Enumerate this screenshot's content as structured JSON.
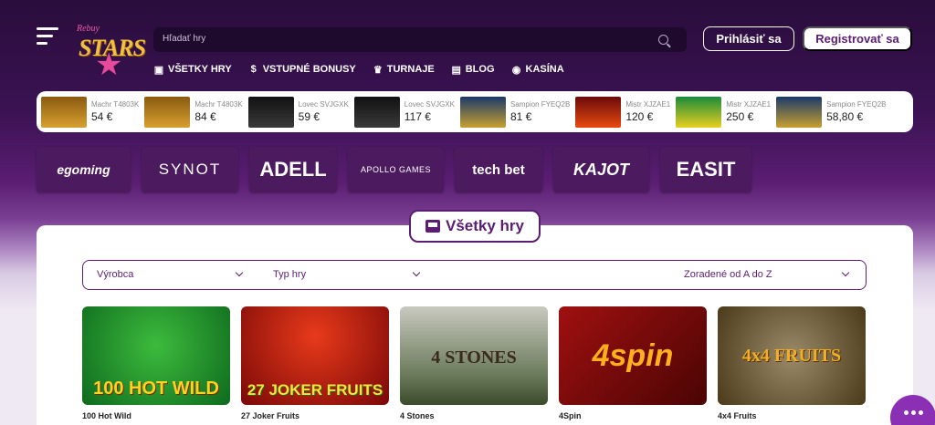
{
  "header": {
    "logo_top": "Rebuy",
    "logo_main": "STARS",
    "search_placeholder": "Hľadať hry",
    "login_label": "Prihlásiť sa",
    "register_label": "Registrovať sa"
  },
  "nav": [
    {
      "icon": "slot-machine-icon",
      "label": "VŠETKY HRY"
    },
    {
      "icon": "dollar-icon",
      "label": "VSTUPNÉ BONUSY"
    },
    {
      "icon": "trophy-icon",
      "label": "TURNAJE"
    },
    {
      "icon": "chat-icon",
      "label": "BLOG"
    },
    {
      "icon": "chips-icon",
      "label": "KASÍNA"
    }
  ],
  "ticker": [
    {
      "user": "Machr T4803K",
      "amount": "54 €",
      "thumb": "4 fruits"
    },
    {
      "user": "Machr T4803K",
      "amount": "84 €",
      "thumb": "4 fruits"
    },
    {
      "user": "Lovec SVJGXK",
      "amount": "59 €",
      "thumb": "zuppa"
    },
    {
      "user": "Lovec SVJGXK",
      "amount": "117 €",
      "thumb": "zuppa"
    },
    {
      "user": "Sampion FYEQ2B",
      "amount": "81 €",
      "thumb": "money vaults"
    },
    {
      "user": "Mistr XJZAE1",
      "amount": "120 €",
      "thumb": "81"
    },
    {
      "user": "Mistr XJZAE1",
      "amount": "250 €",
      "thumb": "hot wild"
    },
    {
      "user": "Sampion FYEQ2B",
      "amount": "58,80 €",
      "thumb": "money vaults"
    }
  ],
  "providers": [
    {
      "label": "egoming",
      "style": "bold-italic"
    },
    {
      "label": "SYNOT",
      "style": "wide"
    },
    {
      "label": "ADELL",
      "style": "heavy"
    },
    {
      "label": "APOLLO GAMES",
      "style": "small"
    },
    {
      "label": "tech bet",
      "style": "stack"
    },
    {
      "label": "KAJOT",
      "style": "italic"
    },
    {
      "label": "EASIT",
      "style": "heavy"
    }
  ],
  "section": {
    "title": "Všetky hry"
  },
  "filters": {
    "manufacturer": "Výrobca",
    "game_type": "Typ hry",
    "sort": "Zoradené od A do Z"
  },
  "games": [
    {
      "title": "100 Hot Wild",
      "art_text": "100 HOT WILD"
    },
    {
      "title": "27 Joker Fruits",
      "art_text": "27 JOKER FRUITS"
    },
    {
      "title": "4 Stones",
      "art_text": "4 STONES"
    },
    {
      "title": "4Spin",
      "art_text": "4spin"
    },
    {
      "title": "4x4 Fruits",
      "art_text": "4x4 FRUITS"
    }
  ],
  "colors": {
    "brand_purple": "#5a1d72",
    "chat_bubble": "#8b2fb5"
  }
}
